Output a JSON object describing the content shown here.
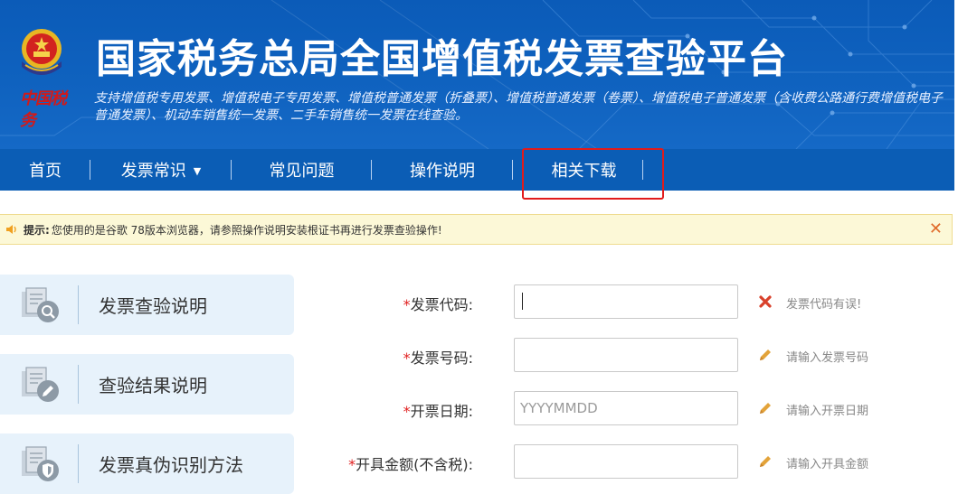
{
  "header": {
    "title": "国家税务总局全国增值税发票查验平台",
    "subtitle": "支持增值税专用发票、增值税电子专用发票、增值税普通发票（折叠票）、增值税普通发票（卷票）、增值税电子普通发票（含收费公路通行费增值税电子普通发票）、机动车销售统一发票、二手车销售统一发票在线查验。",
    "seal_text": "中国税务"
  },
  "nav": {
    "items": [
      {
        "label": "首页"
      },
      {
        "label": "发票常识"
      },
      {
        "label": "常见问题"
      },
      {
        "label": "操作说明"
      },
      {
        "label": "相关下载"
      }
    ]
  },
  "notice": {
    "label": "提示:",
    "message": "您使用的是谷歌 78版本浏览器，请参照操作说明安装根证书再进行发票查验操作!",
    "close": "✕"
  },
  "side": {
    "cards": [
      {
        "label": "发票查验说明",
        "icon": "document-search-icon"
      },
      {
        "label": "查验结果说明",
        "icon": "document-edit-icon"
      },
      {
        "label": "发票真伪识别方法",
        "icon": "document-shield-icon"
      }
    ]
  },
  "form": {
    "fields": [
      {
        "required": "*",
        "label": "发票代码:",
        "value": "",
        "placeholder": "",
        "hint": "发票代码有误!",
        "hint_type": "error"
      },
      {
        "required": "*",
        "label": "发票号码:",
        "value": "",
        "placeholder": "",
        "hint": "请输入发票号码",
        "hint_type": "edit"
      },
      {
        "required": "*",
        "label": "开票日期:",
        "value": "",
        "placeholder": "YYYYMMDD",
        "hint": "请输入开票日期",
        "hint_type": "edit"
      },
      {
        "required": "*",
        "label": "开具金额(不含税):",
        "value": "",
        "placeholder": "",
        "hint": "请输入开具金额",
        "hint_type": "edit"
      }
    ]
  },
  "colors": {
    "banner": "#0f62bf",
    "nav": "#0b5db5",
    "highlight": "#e21b1b",
    "error": "#d9412b",
    "edit": "#e3a33a",
    "card": "#e7f2fb",
    "notice_bg": "#fcf8d7"
  }
}
